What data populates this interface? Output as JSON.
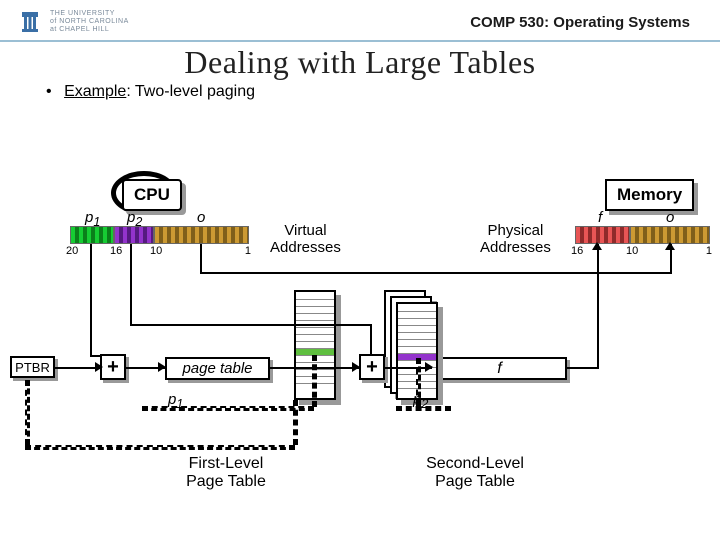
{
  "header": {
    "university_line1": "THE UNIVERSITY",
    "university_line2": "of NORTH CAROLINA",
    "university_line3": "at CHAPEL HILL",
    "course": "COMP 530: Operating Systems"
  },
  "title": "Dealing with Large Tables",
  "example": {
    "label": "Example",
    "text": ": Two-level paging"
  },
  "labels": {
    "cpu": "CPU",
    "memory": "Memory",
    "virtual": "Virtual\nAddresses",
    "physical": "Physical\nAddresses",
    "page_table": "page table",
    "ptbr": "PTBR",
    "plus": "+",
    "f": "f",
    "p1": "p",
    "p1_sub": "1",
    "p2": "p",
    "p2_sub": "2",
    "first_table": "First-Level\nPage Table",
    "second_table": "Second-Level\nPage Table"
  },
  "virtual_address": {
    "fields": [
      {
        "name": "p1",
        "label": "p",
        "sub": "1",
        "tick_left": "20"
      },
      {
        "name": "p2",
        "label": "p",
        "sub": "2",
        "tick_left": "16"
      },
      {
        "name": "o",
        "label": "o",
        "tick_left": "10",
        "tick_right": "1"
      }
    ]
  },
  "physical_address": {
    "fields": [
      {
        "name": "f",
        "label": "f",
        "tick_left": "16"
      },
      {
        "name": "o",
        "label": "o",
        "tick_left": "10",
        "tick_right": "1"
      }
    ]
  }
}
